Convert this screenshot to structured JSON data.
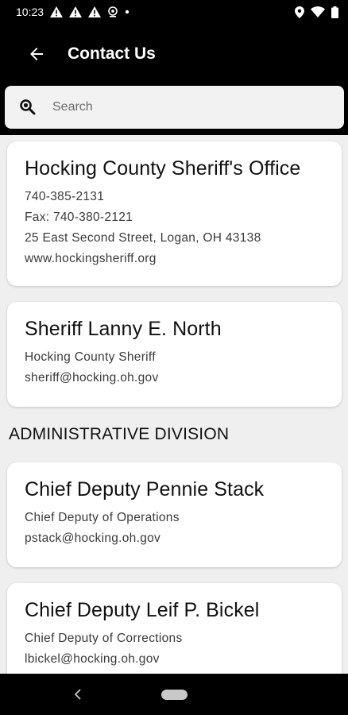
{
  "status": {
    "time": "10:23"
  },
  "app_bar": {
    "title": "Contact Us"
  },
  "search": {
    "placeholder": "Search"
  },
  "cards": [
    {
      "name": "Hocking County Sheriff's Office",
      "lines": [
        "740-385-2131",
        "Fax: 740-380-2121",
        "25 East Second Street, Logan, OH 43138",
        "www.hockingsheriff.org"
      ]
    },
    {
      "name": "Sheriff Lanny E. North",
      "lines": [
        "Hocking County Sheriff",
        "sheriff@hocking.oh.gov"
      ]
    }
  ],
  "section": {
    "title": "ADMINISTRATIVE DIVISION"
  },
  "division_cards": [
    {
      "name": "Chief Deputy Pennie Stack",
      "lines": [
        "Chief Deputy of Operations",
        "pstack@hocking.oh.gov"
      ]
    },
    {
      "name": "Chief Deputy Leif P. Bickel",
      "lines": [
        "Chief Deputy of Corrections",
        "lbickel@hocking.oh.gov"
      ]
    }
  ]
}
